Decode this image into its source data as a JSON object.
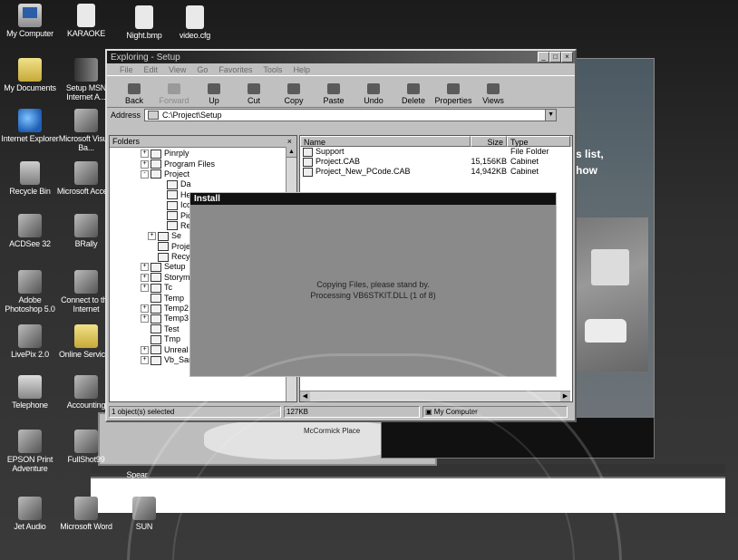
{
  "desktop": {
    "icons_left": [
      {
        "label": "My Computer",
        "icon": "my-computer-icon"
      },
      {
        "label": "My Documents",
        "icon": "my-documents-icon"
      },
      {
        "label": "Internet Explorer",
        "icon": "internet-explorer-icon"
      },
      {
        "label": "Recycle Bin",
        "icon": "recycle-bin-icon"
      },
      {
        "label": "ACDSee 32",
        "icon": "acdsee-icon"
      },
      {
        "label": "Adobe Photoshop 5.0",
        "icon": "photoshop-icon"
      },
      {
        "label": "LivePix 2.0",
        "icon": "livepix-icon"
      },
      {
        "label": "Telephone",
        "icon": "telephone-icon"
      },
      {
        "label": "EPSON Print Adventure",
        "icon": "epson-icon"
      },
      {
        "label": "Jet Audio",
        "icon": "jet-audio-icon"
      }
    ],
    "icons_second": [
      {
        "label": "KARAOKE",
        "icon": "karaoke-file-icon"
      },
      {
        "label": "Setup MSN Internet A...",
        "icon": "msn-icon"
      },
      {
        "label": "Microsoft Visual Ba...",
        "icon": "visual-basic-icon"
      },
      {
        "label": "Microsoft Access",
        "icon": "access-icon"
      },
      {
        "label": "BRally",
        "icon": "brally-icon"
      },
      {
        "label": "Connect to the Internet",
        "icon": "connect-internet-icon"
      },
      {
        "label": "Online Services",
        "icon": "online-services-icon"
      },
      {
        "label": "Accounting",
        "icon": "accounting-icon"
      },
      {
        "label": "FullShot99",
        "icon": "fullshot-icon"
      },
      {
        "label": "Microsoft Word",
        "icon": "word-icon"
      }
    ],
    "icons_top": [
      {
        "label": "Night.bmp",
        "icon": "bitmap-file-icon"
      },
      {
        "label": "video.cfg",
        "icon": "config-file-icon"
      }
    ],
    "extra": {
      "sun_label": "SUN",
      "spear_label": "Spear"
    },
    "poster_text": {
      "line1": "s list,",
      "line2": "how"
    },
    "map_label": "McCormick Place"
  },
  "explorer": {
    "title": "Exploring - Setup",
    "menu": [
      "File",
      "Edit",
      "View",
      "Go",
      "Favorites",
      "Tools",
      "Help"
    ],
    "toolbar": [
      {
        "label": "Back",
        "disabled": false
      },
      {
        "label": "Forward",
        "disabled": true
      },
      {
        "label": "Up",
        "disabled": false
      },
      {
        "label": "Cut",
        "disabled": false
      },
      {
        "label": "Copy",
        "disabled": false
      },
      {
        "label": "Paste",
        "disabled": false
      },
      {
        "label": "Undo",
        "disabled": false
      },
      {
        "label": "Delete",
        "disabled": false
      },
      {
        "label": "Properties",
        "disabled": false
      },
      {
        "label": "Views",
        "disabled": false
      }
    ],
    "address_label": "Address",
    "address_value": "C:\\Project\\Setup",
    "folders_header": "Folders",
    "tree": [
      {
        "label": "Pinrply",
        "pm": "+"
      },
      {
        "label": "Program Files",
        "pm": "+"
      },
      {
        "label": "Project",
        "pm": "-"
      },
      {
        "label": "Da",
        "pm": ""
      },
      {
        "label": "He",
        "pm": ""
      },
      {
        "label": "Ico",
        "pm": ""
      },
      {
        "label": "Pic",
        "pm": ""
      },
      {
        "label": "Re",
        "pm": ""
      },
      {
        "label": "Se",
        "pm": "+"
      },
      {
        "label": "Project",
        "pm": ""
      },
      {
        "label": "Recycl",
        "pm": ""
      },
      {
        "label": "Setup",
        "pm": "+"
      },
      {
        "label": "Storym",
        "pm": "+"
      },
      {
        "label": "Tc",
        "pm": "+"
      },
      {
        "label": "Temp",
        "pm": ""
      },
      {
        "label": "Temp2",
        "pm": "+"
      },
      {
        "label": "Temp3",
        "pm": "+"
      },
      {
        "label": "Test",
        "pm": ""
      },
      {
        "label": "Tmp",
        "pm": ""
      },
      {
        "label": "Unreal",
        "pm": "+"
      },
      {
        "label": "Vb_Samples",
        "pm": "+"
      }
    ],
    "columns": {
      "name": "Name",
      "size": "Size",
      "type": "Type"
    },
    "files": [
      {
        "name": "Support",
        "size": "",
        "type": "File Folder"
      },
      {
        "name": "Project.CAB",
        "size": "15,156KB",
        "type": "Cabinet"
      },
      {
        "name": "Project_New_PCode.CAB",
        "size": "14,942KB",
        "type": "Cabinet"
      }
    ],
    "status": {
      "selected": "1 object(s) selected",
      "size": "127KB",
      "location": "My Computer"
    }
  },
  "install_dialog": {
    "title": "Install",
    "line1": "Copying Files, please stand by.",
    "line2": "Processing VB6STKIT.DLL (1 of 8)"
  }
}
